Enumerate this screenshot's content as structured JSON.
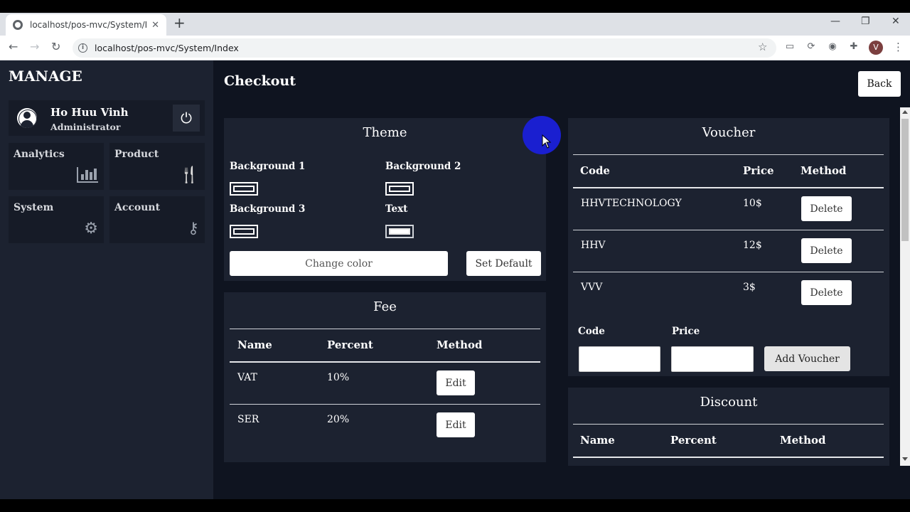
{
  "browser": {
    "tab_title": "localhost/pos-mvc/System/Index",
    "url": "localhost/pos-mvc/System/Index",
    "profile_initial": "V"
  },
  "sidebar": {
    "brand": "MANAGE",
    "user": {
      "name": "Ho Huu Vinh",
      "role": "Administrator"
    },
    "tiles": [
      {
        "label": "Analytics",
        "icon": "bar-chart-icon"
      },
      {
        "label": "Product",
        "icon": "fork-knife-icon"
      },
      {
        "label": "System",
        "icon": "gears-icon"
      },
      {
        "label": "Account",
        "icon": "key-icon"
      }
    ]
  },
  "main": {
    "title": "Checkout",
    "back_label": "Back"
  },
  "theme": {
    "title": "Theme",
    "background1": "Background 1",
    "background2": "Background 2",
    "background3": "Background 3",
    "text": "Text",
    "change_color": "Change color",
    "set_default": "Set Default"
  },
  "fee": {
    "title": "Fee",
    "headers": [
      "Name",
      "Percent",
      "Method"
    ],
    "rows": [
      {
        "name": "VAT",
        "percent": "10%",
        "action": "Edit"
      },
      {
        "name": "SER",
        "percent": "20%",
        "action": "Edit"
      }
    ]
  },
  "voucher": {
    "title": "Voucher",
    "headers": [
      "Code",
      "Price",
      "Method"
    ],
    "rows": [
      {
        "code": "HHVTECHNOLOGY",
        "price": "10$",
        "action": "Delete"
      },
      {
        "code": "HHV",
        "price": "12$",
        "action": "Delete"
      },
      {
        "code": "VVV",
        "price": "3$",
        "action": "Delete"
      }
    ],
    "code_label": "Code",
    "price_label": "Price",
    "add_label": "Add Voucher"
  },
  "discount": {
    "title": "Discount",
    "headers": [
      "Name",
      "Percent",
      "Method"
    ]
  },
  "colors": {
    "sidebar_bg": "#1c2230",
    "app_bg": "#0f1420",
    "panel_bg": "#1c2230",
    "cursor_highlight": "#1a1fd0"
  }
}
